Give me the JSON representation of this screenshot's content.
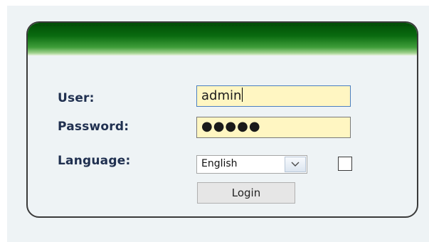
{
  "login_form": {
    "user_label": "User:",
    "password_label": "Password:",
    "language_label": "Language:",
    "user_value": "admin",
    "password_value": "●●●●●",
    "language_selected": "English",
    "login_button_label": "Login",
    "checkbox_checked": false
  },
  "colors": {
    "header_green": "#0a6b10",
    "label_text": "#203050",
    "input_background": "#fff6c2",
    "page_background": "#eef3f5"
  },
  "icons": {
    "select_arrow": "chevron-down-icon"
  }
}
